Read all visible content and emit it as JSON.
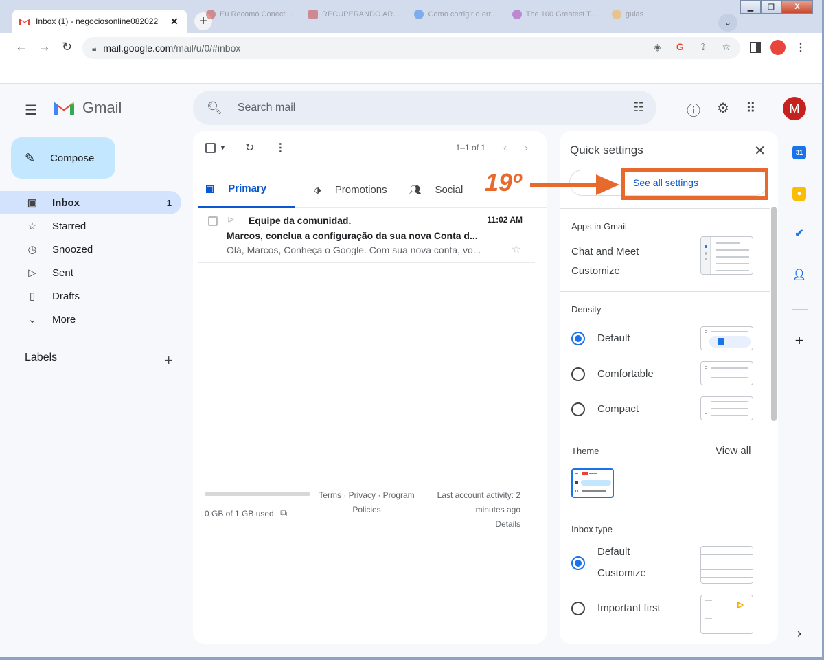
{
  "browser": {
    "active_tab_title": "Inbox (1) - negociosonline082022",
    "url_host": "mail.google.com",
    "url_path": "/mail/u/0/#inbox",
    "background_tabs": [
      "Eu Recomo Conecti...",
      "RECUPERANDO AR...",
      "Como corrigir o err...",
      "The 100 Greatest T...",
      "guias"
    ]
  },
  "gmail": {
    "brand": "Gmail",
    "search_placeholder": "Search mail",
    "avatar_letter": "M",
    "compose_label": "Compose",
    "nav": [
      {
        "label": "Inbox",
        "count": "1",
        "icon": "inbox-icon"
      },
      {
        "label": "Starred",
        "count": "",
        "icon": "star-icon"
      },
      {
        "label": "Snoozed",
        "count": "",
        "icon": "clock-icon"
      },
      {
        "label": "Sent",
        "count": "",
        "icon": "send-icon"
      },
      {
        "label": "Drafts",
        "count": "",
        "icon": "file-icon"
      },
      {
        "label": "More",
        "count": "",
        "icon": "chevron-down-icon"
      }
    ],
    "labels_title": "Labels",
    "range": "1–1 of 1",
    "tabs": [
      "Primary",
      "Promotions",
      "Social"
    ],
    "email": {
      "sender": "Equipe da comunidad.",
      "time": "11:02 AM",
      "subject": "Marcos, conclua a configuração da sua nova Conta d...",
      "snippet": "Olá, Marcos, Conheça o Google. Com sua nova conta, vo..."
    },
    "footer": {
      "storage": "0 GB of 1 GB used",
      "links_line1": "Terms · Privacy · Program",
      "links_line2": "Policies",
      "activity_line1": "Last account activity: 2",
      "activity_line2": "minutes ago",
      "activity_line3": "Details"
    }
  },
  "quick_settings": {
    "title": "Quick settings",
    "see_all": "See all settings",
    "apps_heading": "Apps in Gmail",
    "chat_meet": "Chat and Meet",
    "customize": "Customize",
    "density_heading": "Density",
    "density_options": [
      "Default",
      "Comfortable",
      "Compact"
    ],
    "density_selected": "Default",
    "theme_heading": "Theme",
    "view_all": "View all",
    "inbox_type_heading": "Inbox type",
    "inbox_default": "Default",
    "inbox_customize": "Customize",
    "inbox_important": "Important first"
  },
  "annotation": {
    "step": "19º"
  },
  "colors": {
    "accent": "#0b57d0",
    "annotation": "#e8692c",
    "compose_bg": "#c2e7ff",
    "nav_active": "#d3e3fd"
  }
}
